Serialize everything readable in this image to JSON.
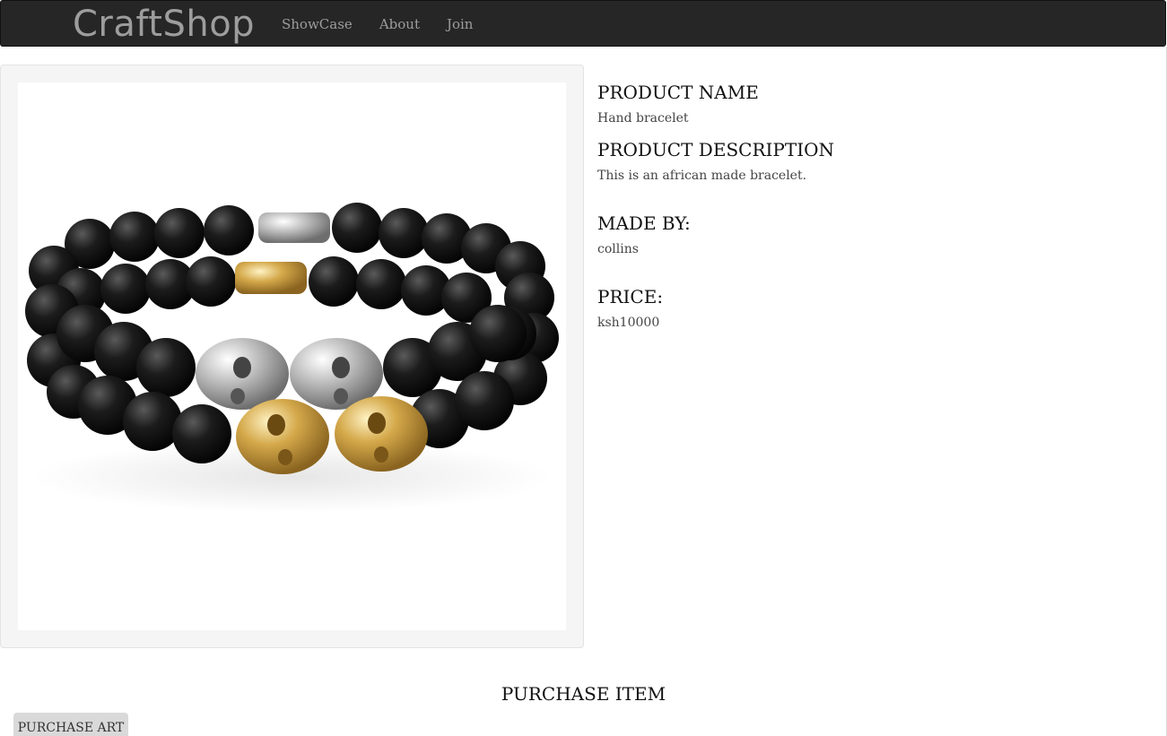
{
  "navbar": {
    "brand": "CraftShop",
    "links": [
      "ShowCase",
      "About",
      "Join"
    ]
  },
  "product": {
    "image_alt": "Hand bracelet",
    "name_heading": "PRODUCT NAME",
    "name": "Hand bracelet",
    "description_heading": "PRODUCT DESCRIPTION",
    "description": "This is an african made bracelet.",
    "maker_heading": "MADE BY:",
    "maker": "collins",
    "price_heading": "PRICE:",
    "price": "ksh10000"
  },
  "purchase": {
    "title": "PURCHASE ITEM",
    "button_label": "PURCHASE ART"
  },
  "colors": {
    "navbar_bg": "#262626",
    "nav_text": "#9d9d9d",
    "panel_bg": "#f5f5f5",
    "button_bg": "#d9d9d9"
  }
}
